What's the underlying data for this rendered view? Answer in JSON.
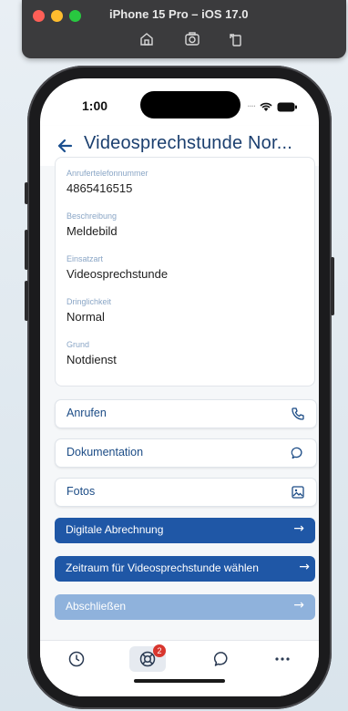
{
  "simulator": {
    "title": "iPhone 15 Pro – iOS 17.0",
    "icons": [
      "home-icon",
      "screenshot-icon",
      "rotate-icon"
    ]
  },
  "status": {
    "time": "1:00"
  },
  "header": {
    "back_icon": "arrow-left-icon",
    "title": "Videosprechstunde Nor..."
  },
  "details": [
    {
      "label": "Anrufertelefonnummer",
      "value": "4865416515"
    },
    {
      "label": "Beschreibung",
      "value": "Meldebild"
    },
    {
      "label": "Einsatzart",
      "value": "Videosprechstunde"
    },
    {
      "label": "Dringlichkeit",
      "value": "Normal"
    },
    {
      "label": "Grund",
      "value": "Notdienst"
    }
  ],
  "actions": [
    {
      "label": "Anrufen",
      "icon": "phone-icon"
    },
    {
      "label": "Dokumentation",
      "icon": "chat-icon"
    },
    {
      "label": "Fotos",
      "icon": "image-icon"
    }
  ],
  "primary_actions": [
    {
      "label": "Digitale Abrechnung",
      "icon": "arrow-right-icon"
    },
    {
      "label": "Zeitraum für Videosprechstunde wählen",
      "icon": "arrow-right-icon"
    },
    {
      "label": "Abschließen",
      "icon": "arrow-right-icon",
      "disabled": true
    }
  ],
  "tabbar": {
    "tabs": [
      "clock-icon",
      "support-icon",
      "chat-icon",
      "more-icon"
    ],
    "badge": "2"
  },
  "colors": {
    "accent": "#1f57a6",
    "title": "#1b3f6f",
    "label": "#8aa6c6",
    "disabled": "#8fb2dc",
    "badge": "#d8362e"
  }
}
